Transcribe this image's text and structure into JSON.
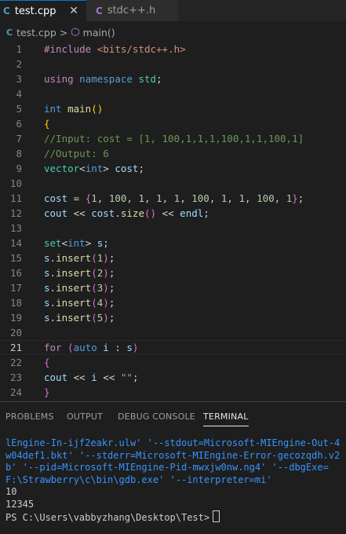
{
  "tabs": [
    {
      "icon": "C",
      "label": "test.cpp",
      "close": "✕"
    },
    {
      "icon": "C",
      "label": "stdc++.h"
    }
  ],
  "breadcrumb": {
    "file": "test.cpp",
    "separator": ">",
    "symbol": "main()"
  },
  "editor": {
    "line_numbers": [
      "1",
      "2",
      "3",
      "4",
      "5",
      "6",
      "7",
      "8",
      "9",
      "10",
      "11",
      "12",
      "13",
      "14",
      "15",
      "16",
      "17",
      "18",
      "19",
      "20",
      "21",
      "22",
      "23",
      "24"
    ],
    "current_line": "21"
  },
  "panel": {
    "tabs": [
      "PROBLEMS",
      "OUTPUT",
      "DEBUG CONSOLE",
      "TERMINAL"
    ],
    "active_tab": "TERMINAL"
  },
  "terminal": {
    "command_text": "lEngine-In-ijf2eakr.ulw' '--stdout=Microsoft-MIEngine-Out-4w04def1.bkt' '--stderr=Microsoft-MIEngine-Error-gecozqdh.v2b' '--pid=Microsoft-MIEngine-Pid-mwxjw0nw.ng4' '--dbgExe=F:\\Strawberry\\c\\bin\\gdb.exe' '--interpreter=mi'",
    "output_lines": [
      "10",
      "12345"
    ],
    "prompt": "PS C:\\Users\\vabbyzhang\\Desktop\\Test>"
  }
}
